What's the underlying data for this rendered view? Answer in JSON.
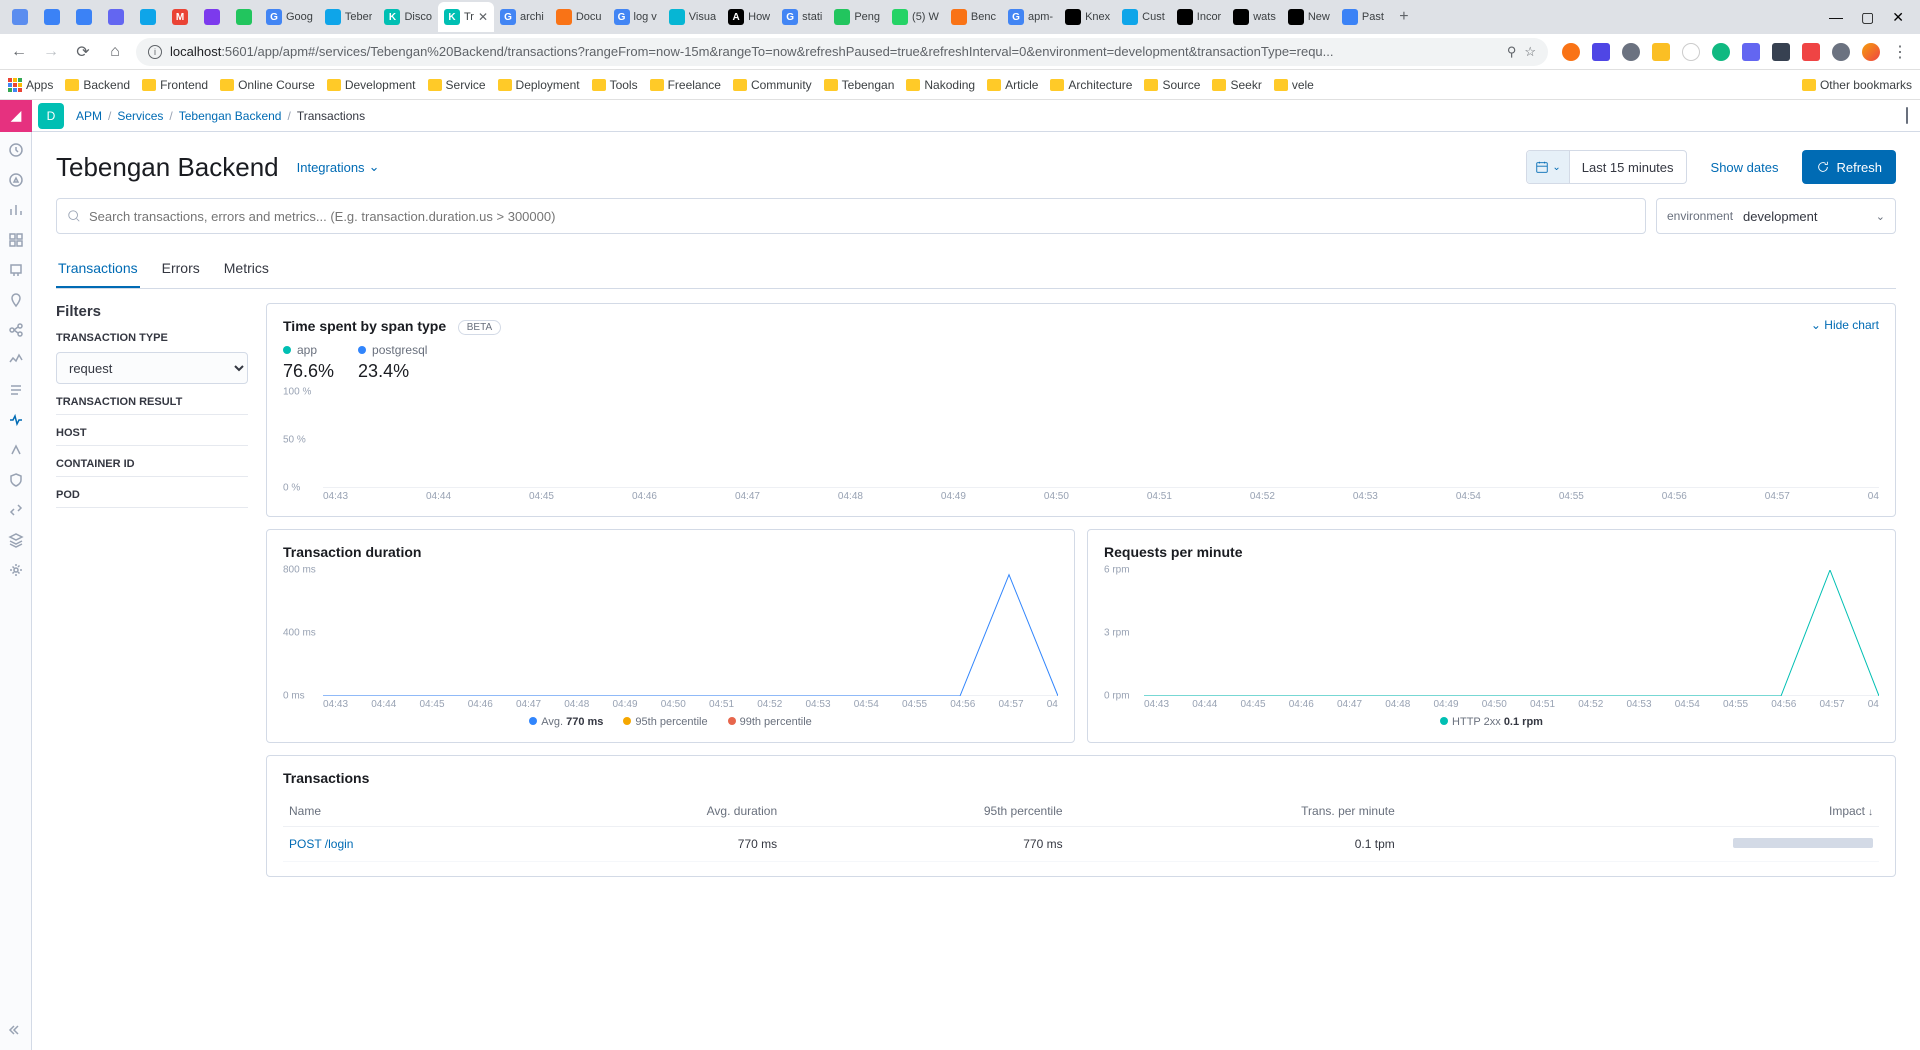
{
  "browser": {
    "tabs": [
      {
        "title": "",
        "color": "#5b8def"
      },
      {
        "title": "",
        "color": "#3b82f6"
      },
      {
        "title": "",
        "color": "#3b82f6"
      },
      {
        "title": "",
        "color": "#6366f1"
      },
      {
        "title": "",
        "color": "#0ea5e9"
      },
      {
        "title": "",
        "color": "#ea4335",
        "icon": "M"
      },
      {
        "title": "",
        "color": "#7c3aed"
      },
      {
        "title": "",
        "color": "#22c55e"
      },
      {
        "title": "Goog",
        "color": "#4285f4",
        "icon": "G"
      },
      {
        "title": "Teber",
        "color": "#0ea5e9"
      },
      {
        "title": "Disco",
        "color": "#00bfb3",
        "icon": "K"
      },
      {
        "title": "Tr",
        "color": "#00bfb3",
        "icon": "K",
        "active": true
      },
      {
        "title": "archi",
        "color": "#4285f4",
        "icon": "G"
      },
      {
        "title": "Docu",
        "color": "#f97316"
      },
      {
        "title": "log v",
        "color": "#4285f4",
        "icon": "G"
      },
      {
        "title": "Visua",
        "color": "#06b6d4"
      },
      {
        "title": "How",
        "color": "#000",
        "icon": "A"
      },
      {
        "title": "stati",
        "color": "#4285f4",
        "icon": "G"
      },
      {
        "title": "Peng",
        "color": "#22c55e"
      },
      {
        "title": "(5) W",
        "color": "#25d366"
      },
      {
        "title": "Benc",
        "color": "#f97316"
      },
      {
        "title": "apm-",
        "color": "#4285f4",
        "icon": "G"
      },
      {
        "title": "Knex",
        "color": "#000"
      },
      {
        "title": "Cust",
        "color": "#0ea5e9"
      },
      {
        "title": "Incor",
        "color": "#000"
      },
      {
        "title": "wats",
        "color": "#000"
      },
      {
        "title": "New",
        "color": "#000"
      },
      {
        "title": "Past",
        "color": "#3b82f6"
      }
    ],
    "url_host": "localhost",
    "url_port": ":5601",
    "url_path": "/app/apm#/services/Tebengan%20Backend/transactions?rangeFrom=now-15m&rangeTo=now&refreshPaused=true&refreshInterval=0&environment=development&transactionType=requ...",
    "bookmarks": [
      "Apps",
      "Backend",
      "Frontend",
      "Online Course",
      "Development",
      "Service",
      "Deployment",
      "Tools",
      "Freelance",
      "Community",
      "Tebengan",
      "Nakoding",
      "Article",
      "Architecture",
      "Source",
      "Seekr",
      "vele"
    ],
    "other_bookmarks": "Other bookmarks"
  },
  "breadcrumb": {
    "items": [
      "APM",
      "Services",
      "Tebengan Backend",
      "Transactions"
    ]
  },
  "page": {
    "title": "Tebengan Backend",
    "integrations": "Integrations",
    "datepicker": "Last 15 minutes",
    "show_dates": "Show dates",
    "refresh": "Refresh"
  },
  "search": {
    "placeholder": "Search transactions, errors and metrics... (E.g. transaction.duration.us > 300000)",
    "env_label": "environment",
    "env_value": "development"
  },
  "tabs": [
    "Transactions",
    "Errors",
    "Metrics"
  ],
  "filters": {
    "title": "Filters",
    "labels": {
      "txtype": "TRANSACTION TYPE",
      "txresult": "TRANSACTION RESULT",
      "host": "HOST",
      "container": "CONTAINER ID",
      "pod": "POD"
    },
    "txtype_value": "request"
  },
  "span_panel": {
    "title": "Time spent by span type",
    "beta": "BETA",
    "hide": "Hide chart",
    "legend": [
      {
        "name": "app",
        "color": "#00bfb3",
        "value": "76.6%"
      },
      {
        "name": "postgresql",
        "color": "#3185fc",
        "value": "23.4%"
      }
    ]
  },
  "duration_panel": {
    "title": "Transaction duration",
    "legend": [
      {
        "name": "Avg.",
        "extra": "770 ms",
        "color": "#3185fc"
      },
      {
        "name": "95th percentile",
        "color": "#f5a700"
      },
      {
        "name": "99th percentile",
        "color": "#e7664c"
      }
    ]
  },
  "rpm_panel": {
    "title": "Requests per minute",
    "legend": [
      {
        "name": "HTTP 2xx",
        "extra": "0.1 rpm",
        "color": "#00bfb3"
      }
    ]
  },
  "tx_table": {
    "title": "Transactions",
    "headers": {
      "name": "Name",
      "avg": "Avg. duration",
      "p95": "95th percentile",
      "tpm": "Trans. per minute",
      "impact": "Impact"
    },
    "rows": [
      {
        "name": "POST /login",
        "avg": "770 ms",
        "p95": "770 ms",
        "tpm": "0.1 tpm"
      }
    ]
  },
  "chart_data": [
    {
      "type": "area",
      "title": "Time spent by span type",
      "ylabel": "%",
      "ylim": [
        0,
        100
      ],
      "x": [
        "04:43",
        "04:44",
        "04:45",
        "04:46",
        "04:47",
        "04:48",
        "04:49",
        "04:50",
        "04:51",
        "04:52",
        "04:53",
        "04:54",
        "04:55",
        "04:56",
        "04:57",
        "04"
      ],
      "series": [
        {
          "name": "app",
          "values": [
            0,
            0,
            0,
            0,
            0,
            0,
            0,
            0,
            0,
            0,
            0,
            0,
            0,
            0,
            0,
            0
          ]
        },
        {
          "name": "postgresql",
          "values": [
            0,
            0,
            0,
            0,
            0,
            0,
            0,
            0,
            0,
            0,
            0,
            0,
            0,
            0,
            0,
            0
          ]
        }
      ],
      "yticks": [
        "100 %",
        "50 %",
        "0 %"
      ]
    },
    {
      "type": "line",
      "title": "Transaction duration",
      "ylabel": "ms",
      "ylim": [
        0,
        800
      ],
      "x": [
        "04:43",
        "04:44",
        "04:45",
        "04:46",
        "04:47",
        "04:48",
        "04:49",
        "04:50",
        "04:51",
        "04:52",
        "04:53",
        "04:54",
        "04:55",
        "04:56",
        "04:57",
        "04"
      ],
      "series": [
        {
          "name": "Avg.",
          "values": [
            null,
            null,
            null,
            null,
            null,
            null,
            null,
            null,
            null,
            null,
            null,
            null,
            null,
            null,
            770,
            null
          ]
        },
        {
          "name": "95th percentile",
          "values": [
            null,
            null,
            null,
            null,
            null,
            null,
            null,
            null,
            null,
            null,
            null,
            null,
            null,
            null,
            null,
            null
          ]
        },
        {
          "name": "99th percentile",
          "values": [
            null,
            null,
            null,
            null,
            null,
            null,
            null,
            null,
            null,
            null,
            null,
            null,
            null,
            null,
            null,
            null
          ]
        }
      ],
      "yticks": [
        "800 ms",
        "400 ms",
        "0 ms"
      ]
    },
    {
      "type": "line",
      "title": "Requests per minute",
      "ylabel": "rpm",
      "ylim": [
        0,
        6
      ],
      "x": [
        "04:43",
        "04:44",
        "04:45",
        "04:46",
        "04:47",
        "04:48",
        "04:49",
        "04:50",
        "04:51",
        "04:52",
        "04:53",
        "04:54",
        "04:55",
        "04:56",
        "04:57",
        "04"
      ],
      "series": [
        {
          "name": "HTTP 2xx",
          "values": [
            0,
            0,
            0,
            0,
            0,
            0,
            0,
            0,
            0,
            0,
            0,
            0,
            0,
            0,
            6,
            0
          ]
        }
      ],
      "yticks": [
        "6 rpm",
        "3 rpm",
        "0 rpm"
      ]
    }
  ]
}
